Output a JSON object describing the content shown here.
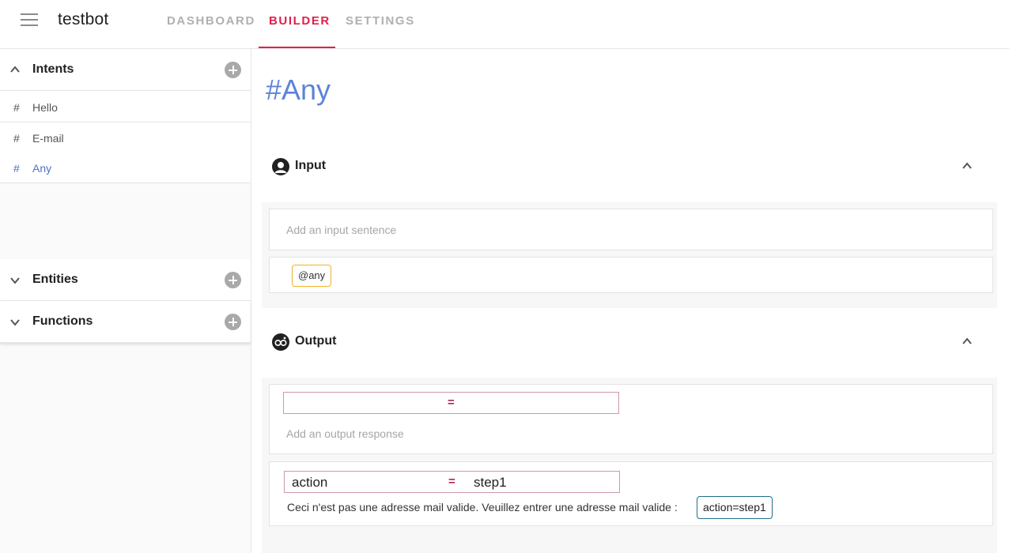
{
  "app": {
    "title": "testbot"
  },
  "nav": {
    "tabs": [
      {
        "label": "DASHBOARD"
      },
      {
        "label": "BUILDER"
      },
      {
        "label": "SETTINGS"
      }
    ],
    "active_tab": "BUILDER"
  },
  "sidebar": {
    "intents": {
      "title": "Intents",
      "items": [
        {
          "hash": "#",
          "label": "Hello"
        },
        {
          "hash": "#",
          "label": "E-mail"
        },
        {
          "hash": "#",
          "label": "Any"
        }
      ],
      "active_item": "Any"
    },
    "entities": {
      "title": "Entities"
    },
    "functions": {
      "title": "Functions"
    }
  },
  "main": {
    "title": "#Any",
    "input": {
      "title": "Input",
      "placeholder": "Add an input sentence",
      "sentence_chip": "@any"
    },
    "output": {
      "title": "Output",
      "new_response": {
        "eq": "=",
        "placeholder": "Add an output response"
      },
      "response": {
        "key": "action",
        "eq": "=",
        "value": "step1",
        "text": "Ceci n'est pas une adresse mail valide. Veuillez entrer une adresse mail valide :",
        "chip": "action=step1"
      }
    }
  },
  "colors": {
    "accent": "#e0204a",
    "title_blue": "#5b84d8",
    "entity_chip_border": "#f0b429",
    "action_chip_border": "#1e6f8a"
  }
}
